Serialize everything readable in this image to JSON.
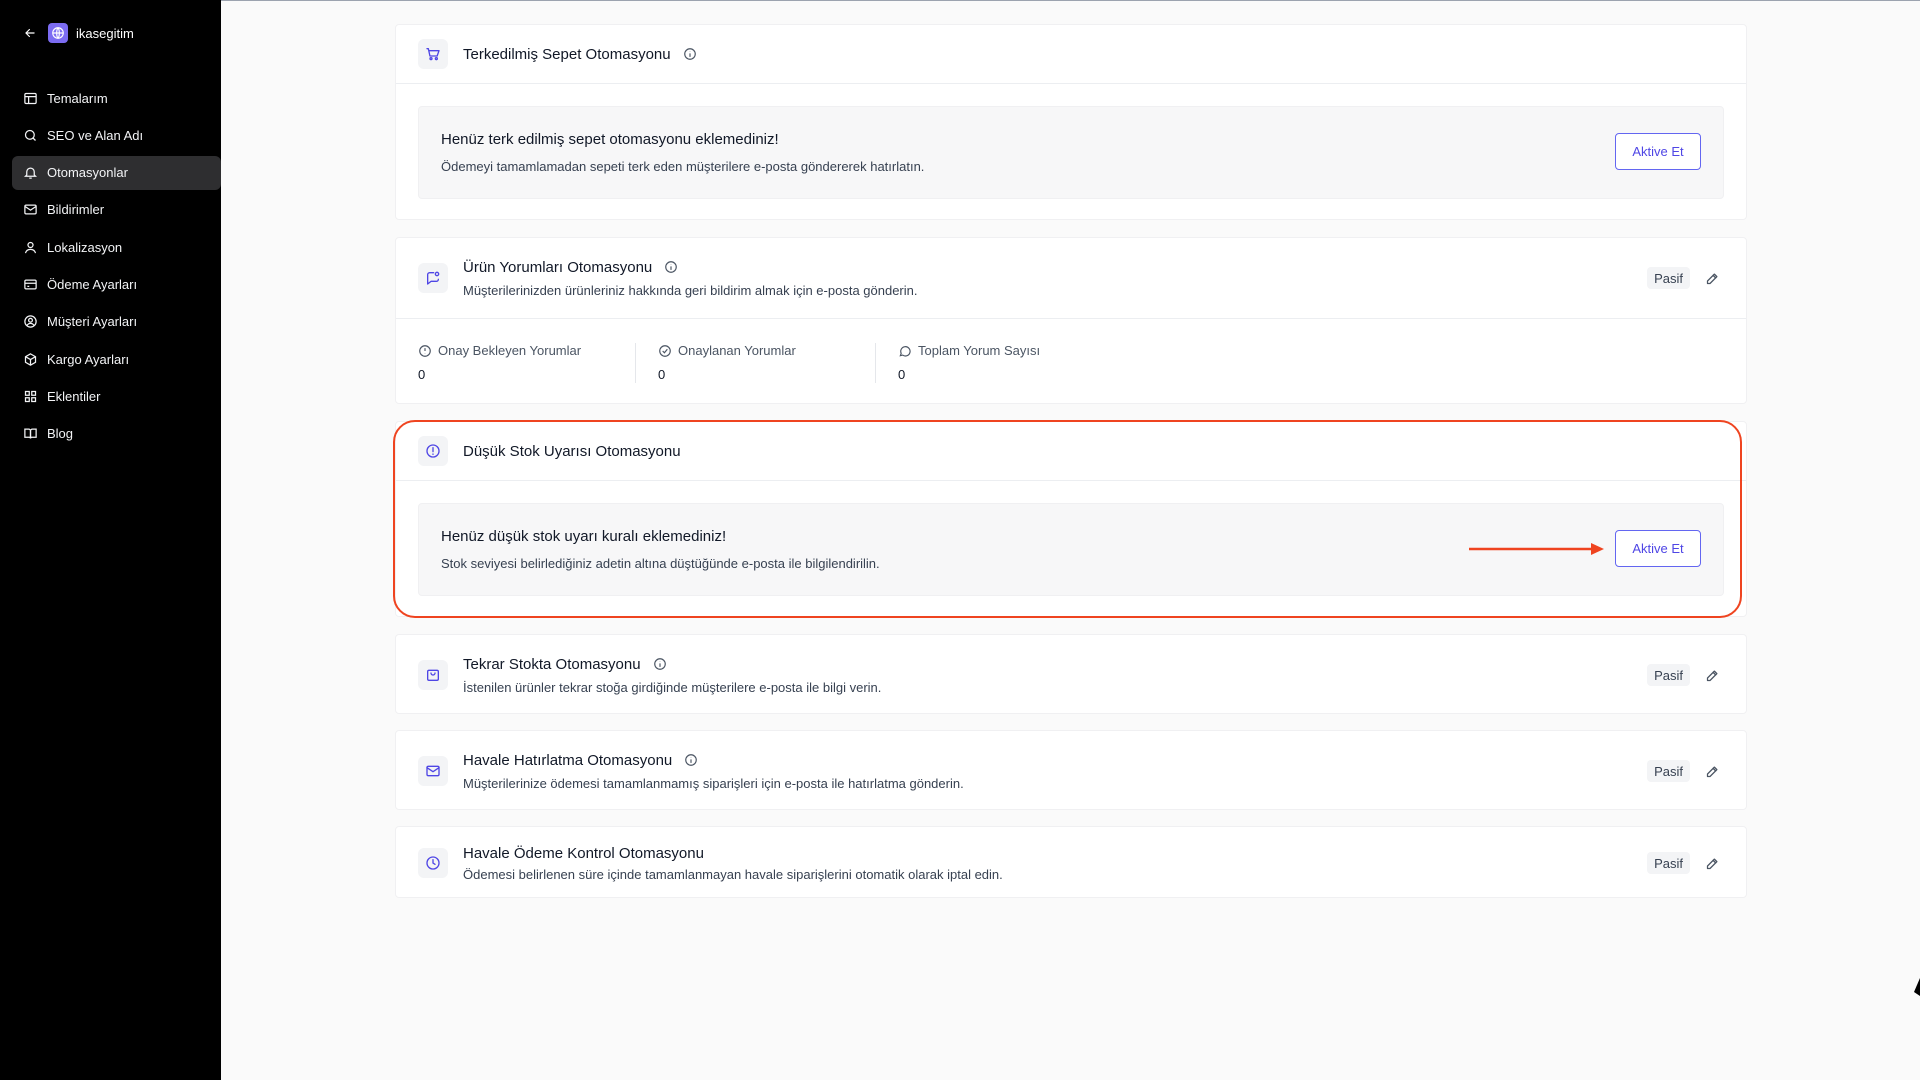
{
  "sidebar": {
    "store_name": "ikasegitim",
    "items": [
      {
        "label": "Temalarım",
        "icon": "layout-icon",
        "active": false
      },
      {
        "label": "SEO ve Alan Adı",
        "icon": "search-icon",
        "active": false
      },
      {
        "label": "Otomasyonlar",
        "icon": "bell-icon",
        "active": true
      },
      {
        "label": "Bildirimler",
        "icon": "mail-icon",
        "active": false
      },
      {
        "label": "Lokalizasyon",
        "icon": "user-location-icon",
        "active": false
      },
      {
        "label": "Ödeme Ayarları",
        "icon": "credit-card-icon",
        "active": false
      },
      {
        "label": "Müşteri Ayarları",
        "icon": "user-circle-icon",
        "active": false
      },
      {
        "label": "Kargo Ayarları",
        "icon": "package-icon",
        "active": false
      },
      {
        "label": "Eklentiler",
        "icon": "grid-icon",
        "active": false
      },
      {
        "label": "Blog",
        "icon": "book-icon",
        "active": false
      }
    ]
  },
  "automations": {
    "abandoned_cart": {
      "title": "Terkedilmiş Sepet Otomasyonu",
      "empty_title": "Henüz terk edilmiş sepet otomasyonu eklemediniz!",
      "empty_desc": "Ödemeyi tamamlamadan sepeti terk eden müşterilere e-posta göndererek hatırlatın.",
      "button": "Aktive Et"
    },
    "reviews": {
      "title": "Ürün Yorumları Otomasyonu",
      "desc": "Müşterilerinizden ürünleriniz hakkında geri bildirim almak için e-posta gönderin.",
      "status": "Pasif",
      "stats": [
        {
          "label": "Onay Bekleyen Yorumlar",
          "value": "0"
        },
        {
          "label": "Onaylanan Yorumlar",
          "value": "0"
        },
        {
          "label": "Toplam Yorum Sayısı",
          "value": "0"
        }
      ]
    },
    "low_stock": {
      "title": "Düşük Stok Uyarısı Otomasyonu",
      "empty_title": "Henüz düşük stok uyarı kuralı eklemediniz!",
      "empty_desc": "Stok seviyesi belirlediğiniz adetin altına düştüğünde e-posta ile bilgilendirilin.",
      "button": "Aktive Et"
    },
    "back_in_stock": {
      "title": "Tekrar Stokta Otomasyonu",
      "desc": "İstenilen ürünler tekrar stoğa girdiğinde müşterilere e-posta ile bilgi verin.",
      "status": "Pasif"
    },
    "transfer_reminder": {
      "title": "Havale Hatırlatma Otomasyonu",
      "desc": "Müşterilerinize ödemesi tamamlanmamış siparişleri için e-posta ile hatırlatma gönderin.",
      "status": "Pasif"
    },
    "transfer_control": {
      "title": "Havale Ödeme Kontrol Otomasyonu",
      "desc": "Ödemesi belirlenen süre içinde tamamlanmayan havale siparişlerini otomatik olarak iptal edin.",
      "status": "Pasif"
    }
  },
  "colors": {
    "accent": "#4f46e5",
    "highlight": "#ef4420",
    "sidebar_bg": "#000000"
  }
}
